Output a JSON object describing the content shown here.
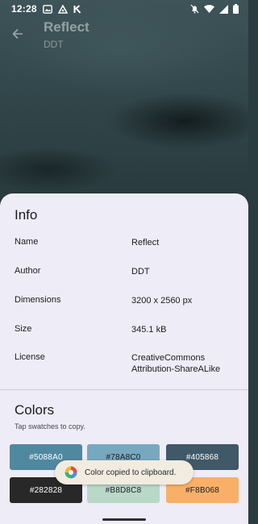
{
  "status_bar": {
    "time": "12:28"
  },
  "app_bar": {
    "title": "Reflect",
    "subtitle": "DDT"
  },
  "info": {
    "heading": "Info",
    "rows": [
      {
        "label": "Name",
        "value": "Reflect"
      },
      {
        "label": "Author",
        "value": "DDT"
      },
      {
        "label": "Dimensions",
        "value": "3200 x 2560 px"
      },
      {
        "label": "Size",
        "value": "345.1 kB"
      },
      {
        "label": "License",
        "value": "CreativeCommons\nAttribution-ShareALike"
      }
    ]
  },
  "colors": {
    "heading": "Colors",
    "hint": "Tap swatches to copy.",
    "swatches": [
      {
        "label": "#5088A0",
        "color": "#5088A0"
      },
      {
        "label": "#78A8C0",
        "color": "#78A8C0"
      },
      {
        "label": "#405868",
        "color": "#405868"
      },
      {
        "label": "#282828",
        "color": "#282828"
      },
      {
        "label": "#B8D8C8",
        "color": "#B8D8C8"
      },
      {
        "label": "#F8B068",
        "color": "#F8B068"
      }
    ]
  },
  "toast": {
    "message": "Color copied to clipboard."
  },
  "icons": {
    "back": "arrow-back-icon",
    "toast": "app-logo-icon"
  }
}
